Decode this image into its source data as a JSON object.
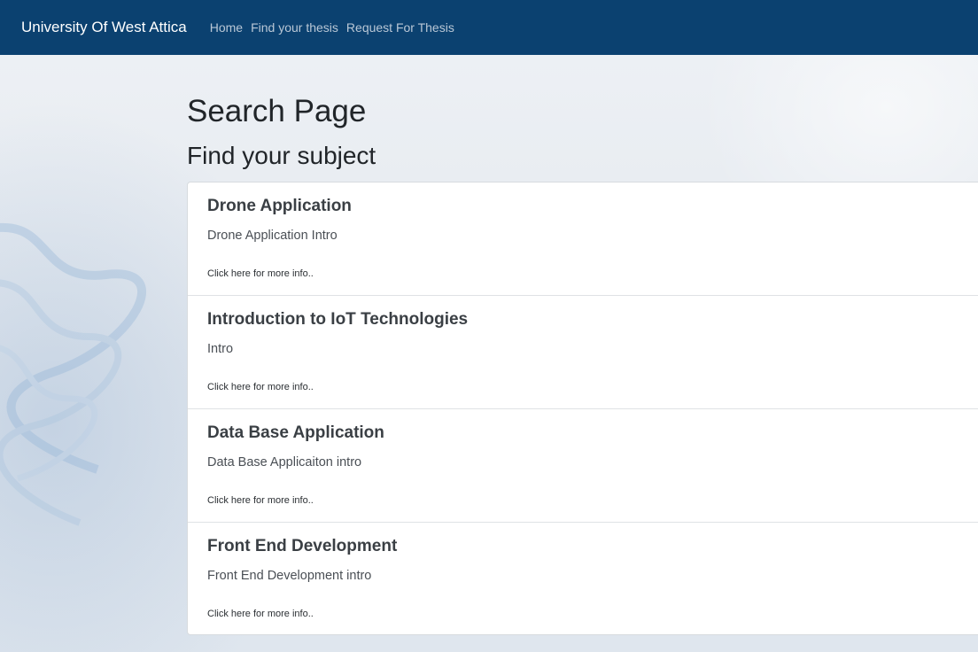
{
  "navbar": {
    "brand": "University Of West Attica",
    "links": [
      {
        "label": "Home"
      },
      {
        "label": "Find your thesis"
      },
      {
        "label": "Request For Thesis"
      }
    ]
  },
  "main": {
    "title": "Search Page",
    "subtitle": "Find your subject",
    "items": [
      {
        "title": "Drone Application",
        "intro": "Drone Application Intro",
        "link": "Click here for more info.."
      },
      {
        "title": "Introduction to IoT Technologies",
        "intro": "Intro",
        "link": "Click here for more info.."
      },
      {
        "title": "Data Base Application",
        "intro": "Data Base Applicaiton intro",
        "link": "Click here for more info.."
      },
      {
        "title": "Front End Development",
        "intro": "Front End Development intro",
        "link": "Click here for more info.."
      }
    ]
  },
  "colors": {
    "navbar_bg": "#0b4170",
    "page_bg": "#e7ebf0",
    "card_bg": "#ffffff"
  }
}
